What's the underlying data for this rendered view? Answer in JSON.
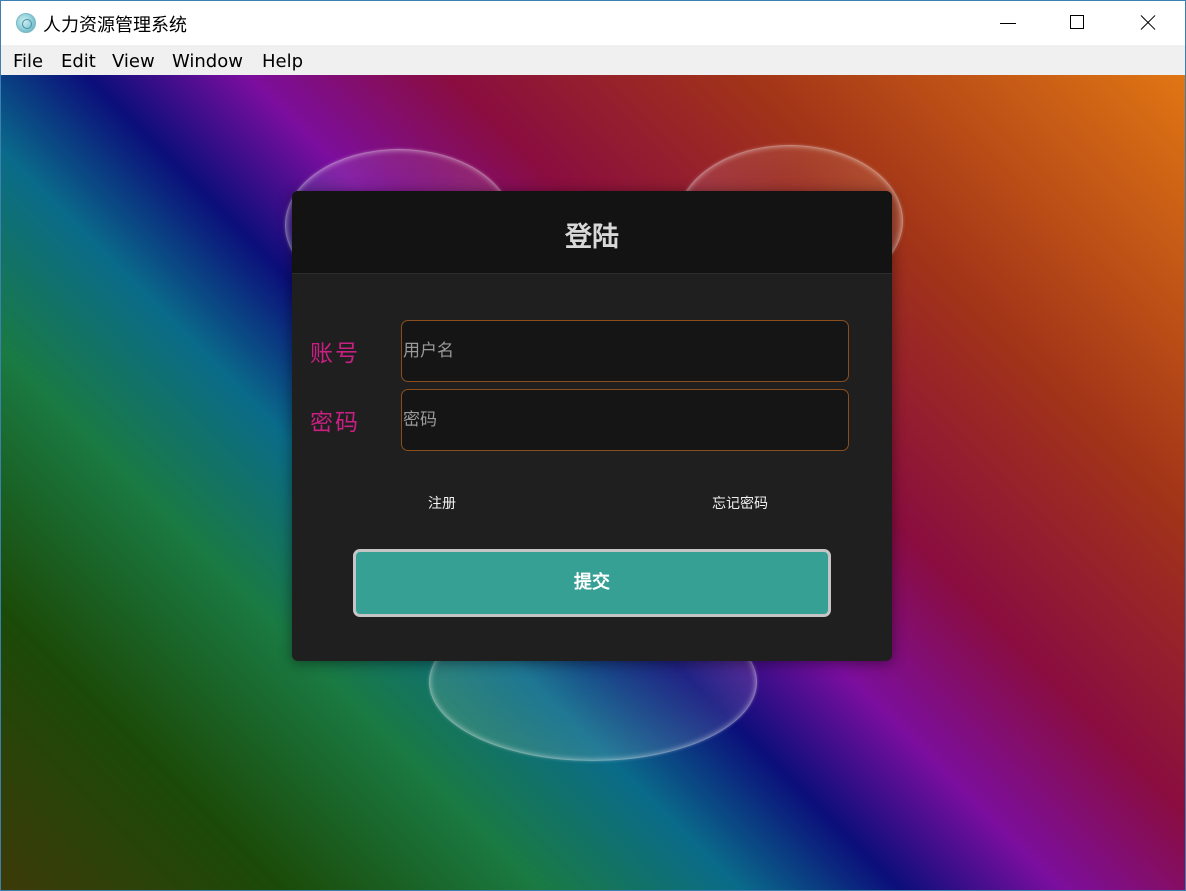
{
  "window": {
    "title": "人力资源管理系统",
    "app_icon": "electron-app-icon",
    "controls": [
      "minimize-icon",
      "maximize-icon",
      "close-icon"
    ]
  },
  "menubar": {
    "items": [
      {
        "label": "File"
      },
      {
        "label": "Edit"
      },
      {
        "label": "View"
      },
      {
        "label": "Window"
      },
      {
        "label": "Help"
      }
    ]
  },
  "login": {
    "title": "登陆",
    "account_label": "账号",
    "account_placeholder": "用户名",
    "account_value": "",
    "password_label": "密码",
    "password_placeholder": "密码",
    "password_value": "",
    "register_link": "注册",
    "forgot_link": "忘记密码",
    "submit_label": "提交"
  },
  "colors": {
    "label_color": "#c81f83",
    "submit_bg": "#36a095",
    "card_bg": "#1f1f1f",
    "field_border": "#8a4e1e"
  }
}
